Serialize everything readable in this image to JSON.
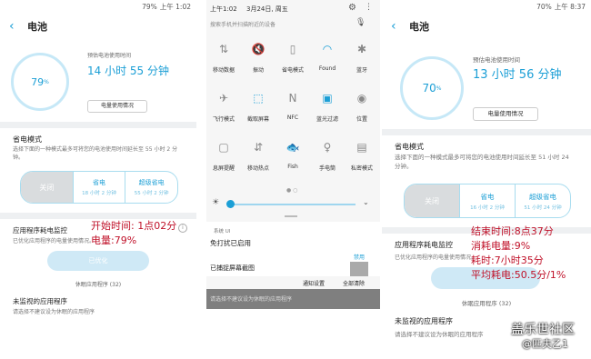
{
  "left": {
    "status": {
      "battery": "79%",
      "time": "上午 1:02"
    },
    "title": "电池",
    "percent": "79",
    "percent_unit": "%",
    "estimate_label": "预估电池使用时间",
    "estimate_value": "14 小时 55 分钟",
    "usage_button": "电量使用情况",
    "save_title": "省电模式",
    "save_desc": "选择下面的一种模式最多可将您的电池使用时间延长至 55 小时 2 分钟。",
    "modes": [
      {
        "label": "关闭",
        "sub": ""
      },
      {
        "label": "省电",
        "sub": "18 小时 2 分钟"
      },
      {
        "label": "超级省电",
        "sub": "55 小时 2 分钟"
      }
    ],
    "monitor_title": "应用程序耗电监控",
    "monitor_desc": "已优化应用程序的电量使用情况。",
    "optimize_button": "已优化",
    "sleeping_apps": "休眠应用程序 (32)",
    "unmonitored_title": "未监视的应用程序",
    "unmonitored_desc": "请选择不建议设为休眠的应用程序",
    "note_start": "开始时间: 1点02分",
    "note_battery": "电量:79%"
  },
  "middle": {
    "status": {
      "time": "上午1:02",
      "date": "3月24日, 周五"
    },
    "search_placeholder": "搜索手机并扫描附近的设备",
    "tiles": [
      {
        "icon": "⇅",
        "label": "移动数据",
        "on": false
      },
      {
        "icon": "🔇",
        "label": "振动",
        "on": true
      },
      {
        "icon": "▯",
        "label": "省电模式",
        "on": false
      },
      {
        "icon": "◠",
        "label": "Found",
        "on": true
      },
      {
        "icon": "✱",
        "label": "蓝牙",
        "on": false
      },
      {
        "icon": "✈",
        "label": "飞行模式",
        "on": false
      },
      {
        "icon": "⬚",
        "label": "截取屏幕",
        "on": true
      },
      {
        "icon": "N",
        "label": "NFC",
        "on": false
      },
      {
        "icon": "▣",
        "label": "蓝光过滤",
        "on": true
      },
      {
        "icon": "◉",
        "label": "位置",
        "on": false
      },
      {
        "icon": "▢",
        "label": "息屏提醒",
        "on": false
      },
      {
        "icon": "⇵",
        "label": "移动热点",
        "on": false
      },
      {
        "icon": "🐟",
        "label": "Fish",
        "on": true
      },
      {
        "icon": "♀",
        "label": "手电筒",
        "on": false
      },
      {
        "icon": "▤",
        "label": "私密模式",
        "on": false
      }
    ],
    "system_ui": "系统 UI",
    "dnd": "免打扰已启用",
    "disable": "禁用",
    "screenshot_notice": "已捕捉屏幕截图",
    "notif_settings": "通知设置",
    "clear_all": "全部清除",
    "bottom_hint": "请选择不建议设为休眠的应用程序"
  },
  "right": {
    "status": {
      "battery": "70%",
      "time": "上午 8:37"
    },
    "title": "电池",
    "percent": "70",
    "percent_unit": "%",
    "estimate_label": "预估电池使用时间",
    "estimate_value": "13 小时 56 分钟",
    "usage_button": "电量使用情况",
    "save_title": "省电模式",
    "save_desc": "选择下面的一种模式最多可将您的电池使用时间延长至 51 小时 24 分钟。",
    "modes": [
      {
        "label": "关闭",
        "sub": ""
      },
      {
        "label": "省电",
        "sub": "16 小时 2 分钟"
      },
      {
        "label": "超级省电",
        "sub": "51 小时 24 分钟"
      }
    ],
    "monitor_title": "应用程序耗电监控",
    "monitor_desc": "已优化应用程序的电量使用情况。",
    "sleeping_apps": "休眠应用程序 (32)",
    "unmonitored_title": "未监视的应用程序",
    "unmonitored_desc": "请选择不建议设为休眠的应用程序",
    "note_end": "结束时间:8点37分",
    "note_used": "消耗电量:9%",
    "note_duration": "耗时:7小时35分",
    "note_avg": "平均耗电:50.5分/1%"
  },
  "watermark": {
    "site": "盖乐世社区",
    "author": "@匹夫乙1"
  }
}
